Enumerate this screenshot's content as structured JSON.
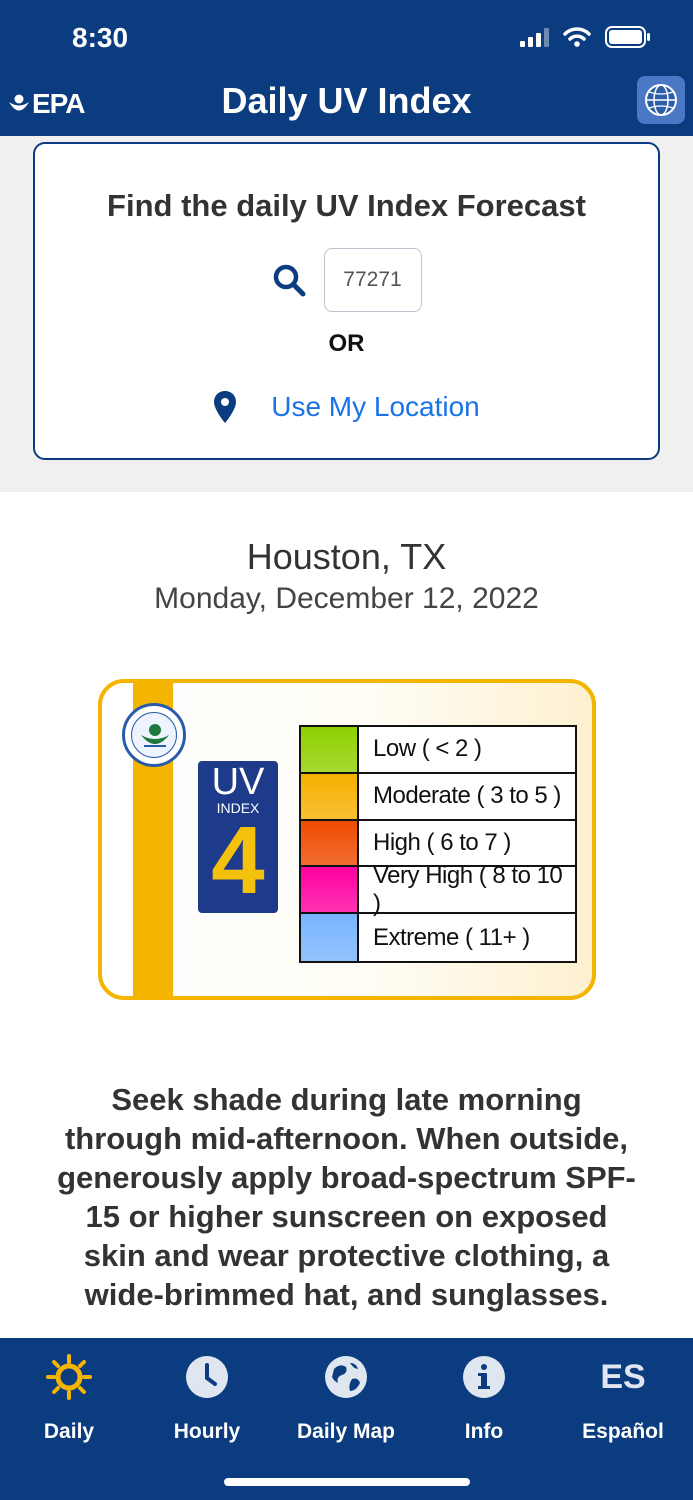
{
  "status_bar": {
    "time": "8:30"
  },
  "header": {
    "logo_text": "EPA",
    "title": "Daily UV Index",
    "globe_icon": "globe-icon"
  },
  "search": {
    "heading": "Find the daily UV Index Forecast",
    "zip_value": "77271",
    "or_label": "OR",
    "location_link": "Use My Location"
  },
  "location": {
    "city": "Houston, TX",
    "date": "Monday, December 12, 2022"
  },
  "uv_index": {
    "label": "UV",
    "sublabel": "INDEX",
    "value": "4",
    "scale": [
      {
        "label": "Low ( < 2 )",
        "color": "#8fd000"
      },
      {
        "label": "Moderate ( 3 to 5 )",
        "color": "#f6b000"
      },
      {
        "label": "High ( 6 to 7 )",
        "color": "#ee4a00"
      },
      {
        "label": "Very High ( 8 to 10 )",
        "color": "#ff00a0"
      },
      {
        "label": "Extreme ( 11+ )",
        "color": "#78b4ff"
      }
    ]
  },
  "advice": "Seek shade during late morning through mid-afternoon. When outside, generously apply broad-spectrum SPF-15 or higher sunscreen on exposed skin  and wear protective clothing, a wide-brimmed hat, and sunglasses.",
  "tabs": [
    {
      "label": "Daily",
      "icon": "sun-icon",
      "active": true
    },
    {
      "label": "Hourly",
      "icon": "clock-icon"
    },
    {
      "label": "Daily Map",
      "icon": "globe-icon"
    },
    {
      "label": "Info",
      "icon": "info-icon"
    },
    {
      "label": "Español",
      "icon": "es-icon",
      "icon_text": "ES"
    }
  ],
  "colors": {
    "brand_blue": "#0b3c7f",
    "link_blue": "#1a73e8",
    "uv_yellow": "#f4b400",
    "active_tab": "#f4b400"
  }
}
